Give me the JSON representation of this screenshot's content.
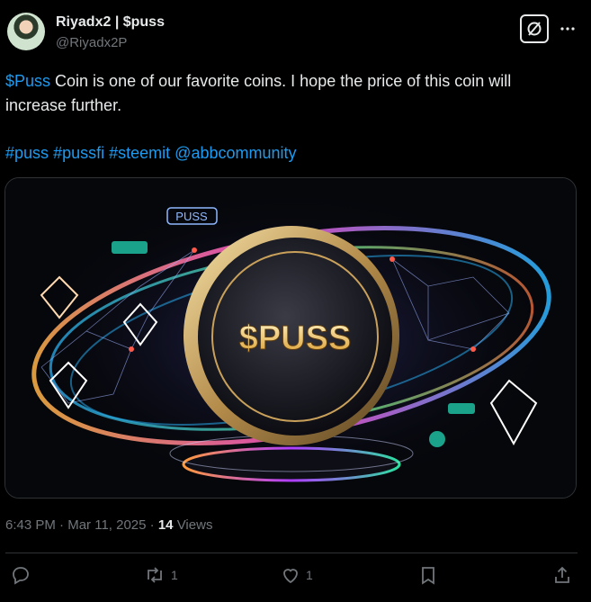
{
  "author": {
    "name": "Riyadx2 | $puss",
    "handle": "@Riyadx2P",
    "avatar_icon": "user-avatar"
  },
  "header_icons": [
    "grok-icon",
    "more-icon"
  ],
  "tweet": {
    "cashtag": "$Puss",
    "text": " Coin is one of our favorite coins. I hope the price of this coin will increase further.",
    "hashtags": [
      "#puss",
      "#pussfi",
      "#steemit",
      "@abbcommunity"
    ]
  },
  "media": {
    "coin_text": "$PUSS",
    "badge_text": "PUSS"
  },
  "meta": {
    "time": "6:43 PM",
    "sep1": " · ",
    "date": "Mar 11, 2025",
    "sep2": " · ",
    "views_count": "14",
    "views_label": " Views"
  },
  "actions": {
    "reply_count": "",
    "retweet_count": "1",
    "like_count": "1"
  },
  "colors": {
    "accent": "#1d9bf0",
    "text": "#e7e9ea",
    "muted": "#71767b",
    "border": "#2f3336"
  }
}
